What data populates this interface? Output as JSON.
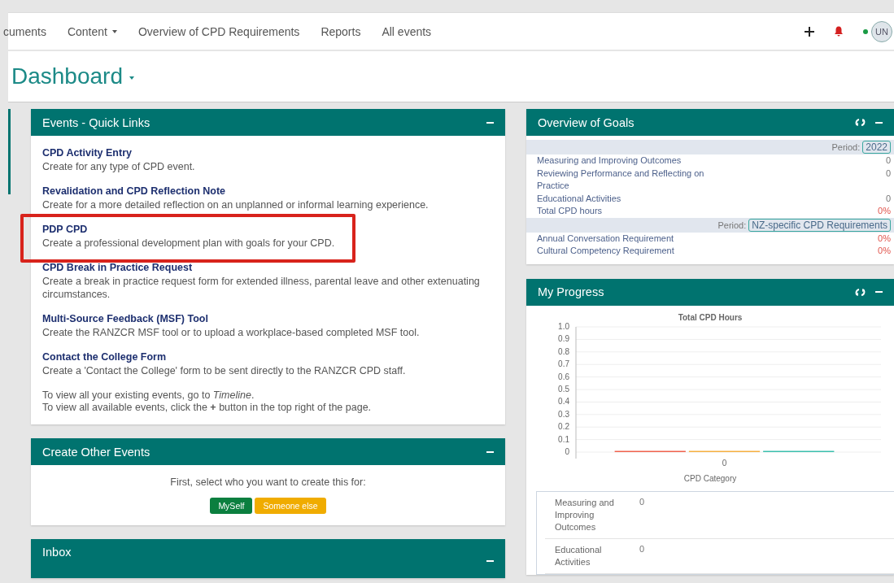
{
  "nav": {
    "items": [
      {
        "label": "cuments",
        "dropdown": false
      },
      {
        "label": "Content",
        "dropdown": true
      },
      {
        "label": "Overview of CPD Requirements",
        "dropdown": false
      },
      {
        "label": "Reports",
        "dropdown": false
      },
      {
        "label": "All events",
        "dropdown": false
      }
    ],
    "user": {
      "initials": "UN",
      "online": true
    }
  },
  "page_title": "Dashboard",
  "quick_links": {
    "title": "Events - Quick Links",
    "items": [
      {
        "title": "CPD Activity Entry",
        "description": "Create for any type of CPD event.",
        "highlighted": false
      },
      {
        "title": "Revalidation and CPD Reflection Note",
        "description": "Create for a more detailed reflection on an unplanned or informal learning experience.",
        "highlighted": false
      },
      {
        "title": "PDP CPD",
        "description": "Create a professional development plan with goals for your CPD.",
        "highlighted": true
      },
      {
        "title": "CPD Break in Practice Request",
        "description": "Create a break in practice request form for extended illness, parental leave and other extenuating circumstances.",
        "highlighted": false
      },
      {
        "title": "Multi-Source Feedback (MSF) Tool",
        "description": "Create the RANZCR MSF tool or to upload a workplace-based completed MSF tool.",
        "highlighted": false
      },
      {
        "title": "Contact the College Form",
        "description": "Create a 'Contact the College' form to be sent directly to the RANZCR CPD staff.",
        "highlighted": false
      }
    ],
    "notes": [
      "To view all your existing events, go to *Timeline*.",
      "To view all available events, click the **+** button in the top right of the page."
    ]
  },
  "create_other": {
    "title": "Create Other Events",
    "prompt": "First, select who you want to create this for:",
    "buttons": [
      {
        "label": "MySelf",
        "kind": "primary"
      },
      {
        "label": "Someone else",
        "kind": "warning"
      }
    ]
  },
  "inbox": {
    "title": "Inbox"
  },
  "goals": {
    "title": "Overview of Goals",
    "groups": [
      {
        "period_label": "Period:",
        "period": "2022",
        "rows": [
          {
            "label": "Measuring and Improving Outcomes",
            "value": "0",
            "kind": "count"
          },
          {
            "label": "Reviewing Performance and Reflecting on Practice",
            "value": "0",
            "kind": "count"
          },
          {
            "label": "Educational Activities",
            "value": "0",
            "kind": "count"
          },
          {
            "label": "Total CPD hours",
            "value": "0%",
            "kind": "percent"
          }
        ]
      },
      {
        "period_label": "Period:",
        "period": "NZ-specific CPD Requirements",
        "rows": [
          {
            "label": "Annual Conversation Requirement",
            "value": "0%",
            "kind": "percent"
          },
          {
            "label": "Cultural Competency Requirement",
            "value": "0%",
            "kind": "percent"
          }
        ]
      }
    ]
  },
  "progress": {
    "title": "My Progress",
    "chart_data": {
      "type": "bar",
      "grid": true,
      "title": "Total CPD Hours",
      "xlabel": "CPD Category",
      "categories": [
        "0"
      ],
      "series": [
        {
          "color": "#f0624d",
          "values": [
            0
          ]
        },
        {
          "color": "#f5b041",
          "values": [
            0
          ]
        },
        {
          "color": "#3cbfae",
          "values": [
            0
          ]
        }
      ],
      "ylim": [
        0,
        1
      ],
      "yticks": [
        {
          "value": 0,
          "label": "0"
        },
        0.1,
        0.2,
        0.3,
        0.4,
        0.5,
        0.6,
        0.7,
        0.8,
        0.9,
        {
          "value": 1,
          "label": "1.0"
        }
      ]
    },
    "table": [
      {
        "label": "Measuring and Improving Outcomes",
        "value": "0"
      },
      {
        "label": "Educational Activities",
        "value": "0"
      }
    ]
  }
}
